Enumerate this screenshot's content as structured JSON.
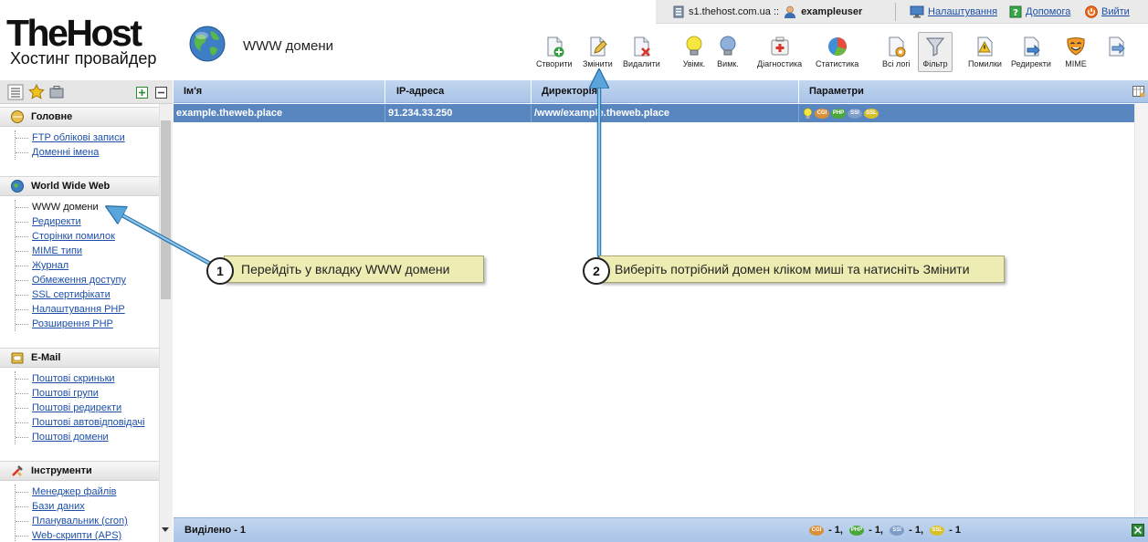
{
  "logo": {
    "main": "TheHost",
    "sub": "Хостинг провайдер"
  },
  "page_title": "WWW домени",
  "topbar": {
    "server": "s1.thehost.com.ua ::",
    "user": "exampleuser",
    "settings": "Налаштування",
    "help": "Допомога",
    "logout": "Вийти"
  },
  "toolbar": {
    "create": "Створити",
    "edit": "Змінити",
    "delete": "Видалити",
    "on": "Увімк.",
    "off": "Вимк.",
    "diagnostics": "Діагностика",
    "statistics": "Статистика",
    "all_logs": "Всі логі",
    "filter": "Фільтр",
    "errors": "Помилки",
    "redirects": "Редиректи",
    "mime": "MIME"
  },
  "sidebar": {
    "sections": [
      {
        "title": "Головне",
        "items": [
          "FTP облікові записи",
          "Доменні імена"
        ]
      },
      {
        "title": "World Wide Web",
        "items": [
          "WWW домени",
          "Редиректи",
          "Сторінки помилок",
          "MIME типи",
          "Журнал",
          "Обмеження доступу",
          "SSL сертифікати",
          "Налаштування PHP",
          "Розширення PHP"
        ]
      },
      {
        "title": "E-Mail",
        "items": [
          "Поштові скриньки",
          "Поштові групи",
          "Поштові редиректи",
          "Поштові автовідповідачі",
          "Поштові домени"
        ]
      },
      {
        "title": "Інструменти",
        "items": [
          "Менеджер файлів",
          "Бази даних",
          "Планувальник (cron)",
          "Web-скрипти (APS)"
        ]
      }
    ]
  },
  "grid": {
    "columns": [
      "Ім'я",
      "IP-адреса",
      "Директорія",
      "Параметри"
    ],
    "row": {
      "name": "example.theweb.place",
      "ip": "91.234.33.250",
      "dir": "/www/example.theweb.place"
    },
    "badges": {
      "cgi": "CGI",
      "php": "PHP",
      "ssi": "SSI",
      "ssl": "SSL"
    },
    "footer": {
      "selected": "Виділено - 1",
      "cgi_count": "- 1,",
      "php_count": "- 1,",
      "ssi_count": "- 1,",
      "ssl_count": "- 1"
    }
  },
  "callouts": {
    "one_num": "1",
    "one_text": "Перейдіть у вкладку WWW домени",
    "two_num": "2",
    "two_text": "Виберіть потрібний домен кліком миші та натисніть Змінити"
  },
  "colors": {
    "header_blue": "#a9c4e8",
    "row_selected": "#5a86c0",
    "callout": "#ededb3",
    "arrow": "#5aa6dc"
  }
}
